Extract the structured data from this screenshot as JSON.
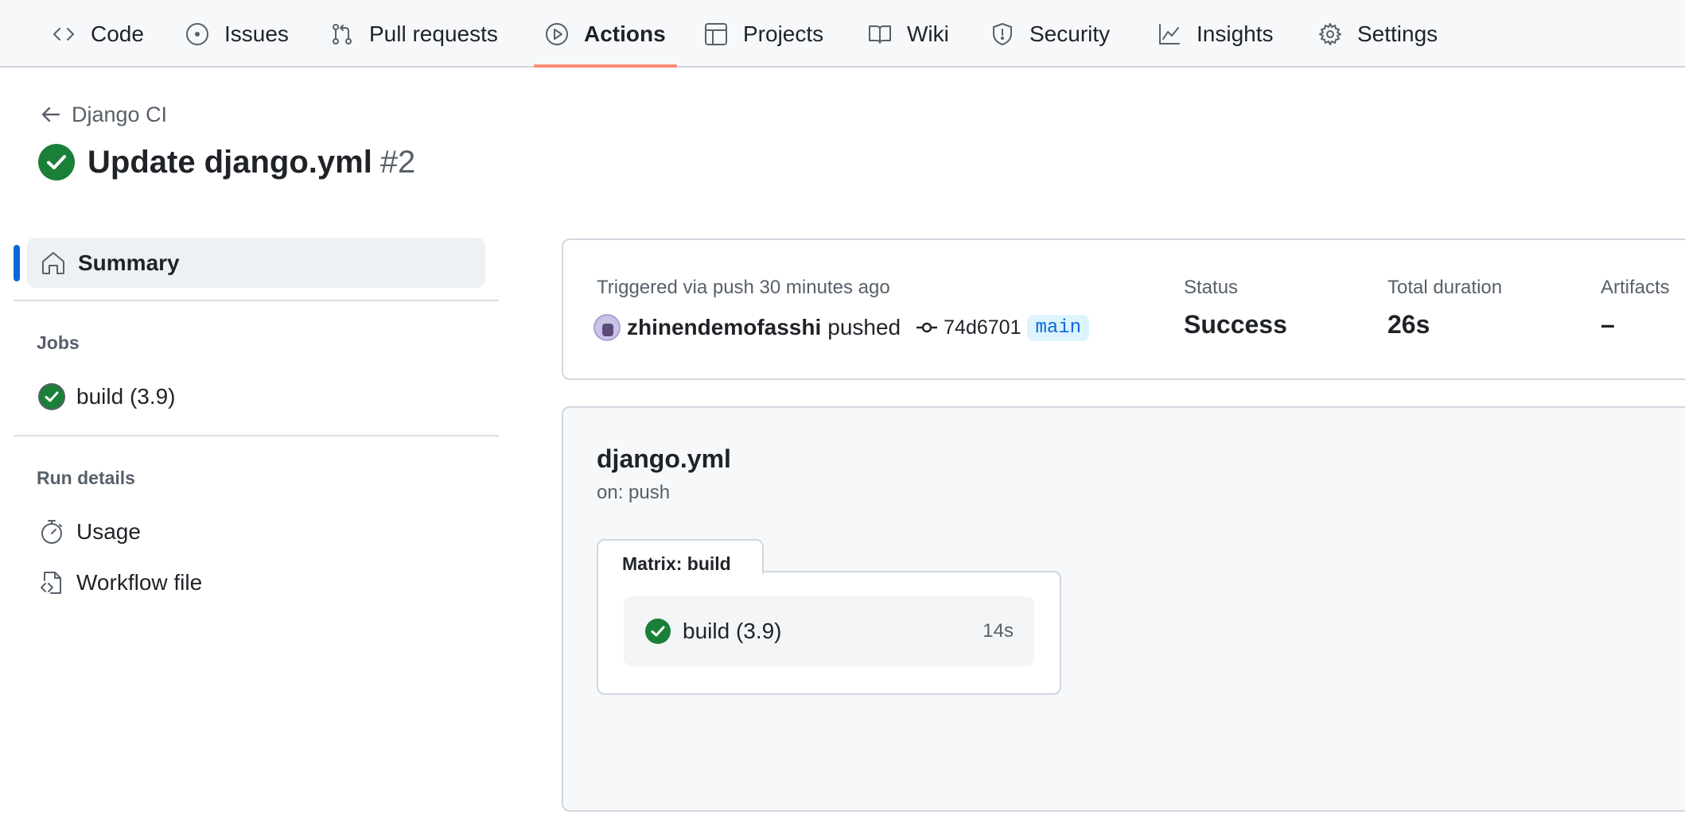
{
  "nav": {
    "tabs": [
      {
        "label": "Code",
        "icon": "code-icon"
      },
      {
        "label": "Issues",
        "icon": "issue-icon"
      },
      {
        "label": "Pull requests",
        "icon": "pull-request-icon"
      },
      {
        "label": "Actions",
        "icon": "play-icon",
        "active": true
      },
      {
        "label": "Projects",
        "icon": "table-icon"
      },
      {
        "label": "Wiki",
        "icon": "book-icon"
      },
      {
        "label": "Security",
        "icon": "shield-icon"
      },
      {
        "label": "Insights",
        "icon": "graph-icon"
      },
      {
        "label": "Settings",
        "icon": "gear-icon"
      }
    ]
  },
  "header": {
    "back_label": "Django CI",
    "title": "Update django.yml",
    "run_number": "#2",
    "status": "success"
  },
  "sidebar": {
    "summary_label": "Summary",
    "jobs_heading": "Jobs",
    "jobs": [
      {
        "label": "build (3.9)",
        "status": "success"
      }
    ],
    "run_details_heading": "Run details",
    "usage_label": "Usage",
    "workflow_file_label": "Workflow file"
  },
  "summary": {
    "triggered_text": "Triggered via push 30 minutes ago",
    "user": "zhinendemofasshi",
    "action": "pushed",
    "commit": "74d6701",
    "branch": "main",
    "status_label": "Status",
    "status_value": "Success",
    "duration_label": "Total duration",
    "duration_value": "26s",
    "artifacts_label": "Artifacts",
    "artifacts_value": "–"
  },
  "graph": {
    "workflow_name": "django.yml",
    "trigger": "on: push",
    "matrix_label": "Matrix: build",
    "job_label": "build (3.9)",
    "job_duration": "14s"
  },
  "colors": {
    "success": "#1a7f37",
    "accent": "#0969da",
    "active_underline": "#fd8c73"
  }
}
